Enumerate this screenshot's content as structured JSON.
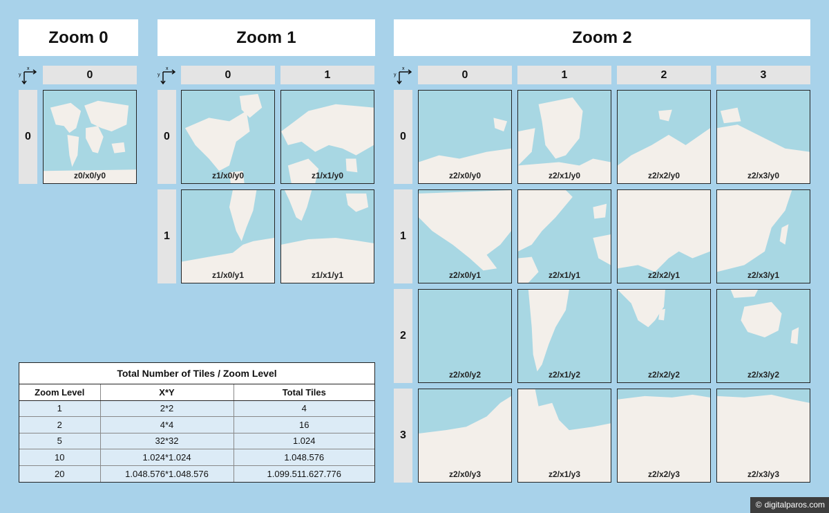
{
  "colors": {
    "background": "#a8d2ea",
    "ocean": "#a8d7e3",
    "land": "#f3efea",
    "header_gray": "#e4e4e4",
    "table_row": "#dcebf6"
  },
  "titles": {
    "zoom0": "Zoom 0",
    "zoom1": "Zoom 1",
    "zoom2": "Zoom 2"
  },
  "axis": {
    "x": "x",
    "y": "y"
  },
  "zoom0": {
    "cols": [
      "0"
    ],
    "rows": [
      "0"
    ],
    "tiles": [
      "z0/x0/y0"
    ]
  },
  "zoom1": {
    "cols": [
      "0",
      "1"
    ],
    "rows": [
      "0",
      "1"
    ],
    "tiles": [
      "z1/x0/y0",
      "z1/x1/y0",
      "z1/x0/y1",
      "z1/x1/y1"
    ]
  },
  "zoom2": {
    "cols": [
      "0",
      "1",
      "2",
      "3"
    ],
    "rows": [
      "0",
      "1",
      "2",
      "3"
    ],
    "tiles": [
      "z2/x0/y0",
      "z2/x1/y0",
      "z2/x2/y0",
      "z2/x3/y0",
      "z2/x0/y1",
      "z2/x1/y1",
      "z2/x2/y1",
      "z2/x3/y1",
      "z2/x0/y2",
      "z2/x1/y2",
      "z2/x2/y2",
      "z2/x3/y2",
      "z2/x0/y3",
      "z2/x1/y3",
      "z2/x2/y3",
      "z2/x3/y3"
    ]
  },
  "table": {
    "caption": "Total Number of Tiles / Zoom Level",
    "headers": [
      "Zoom Level",
      "X*Y",
      "Total Tiles"
    ],
    "rows": [
      [
        "1",
        "2*2",
        "4"
      ],
      [
        "2",
        "4*4",
        "16"
      ],
      [
        "5",
        "32*32",
        "1.024"
      ],
      [
        "10",
        "1.024*1.024",
        "1.048.576"
      ],
      [
        "20",
        "1.048.576*1.048.576",
        "1.099.511.627.776"
      ]
    ]
  },
  "copyright": {
    "symbol": "©",
    "text": "digitalparos.com"
  }
}
